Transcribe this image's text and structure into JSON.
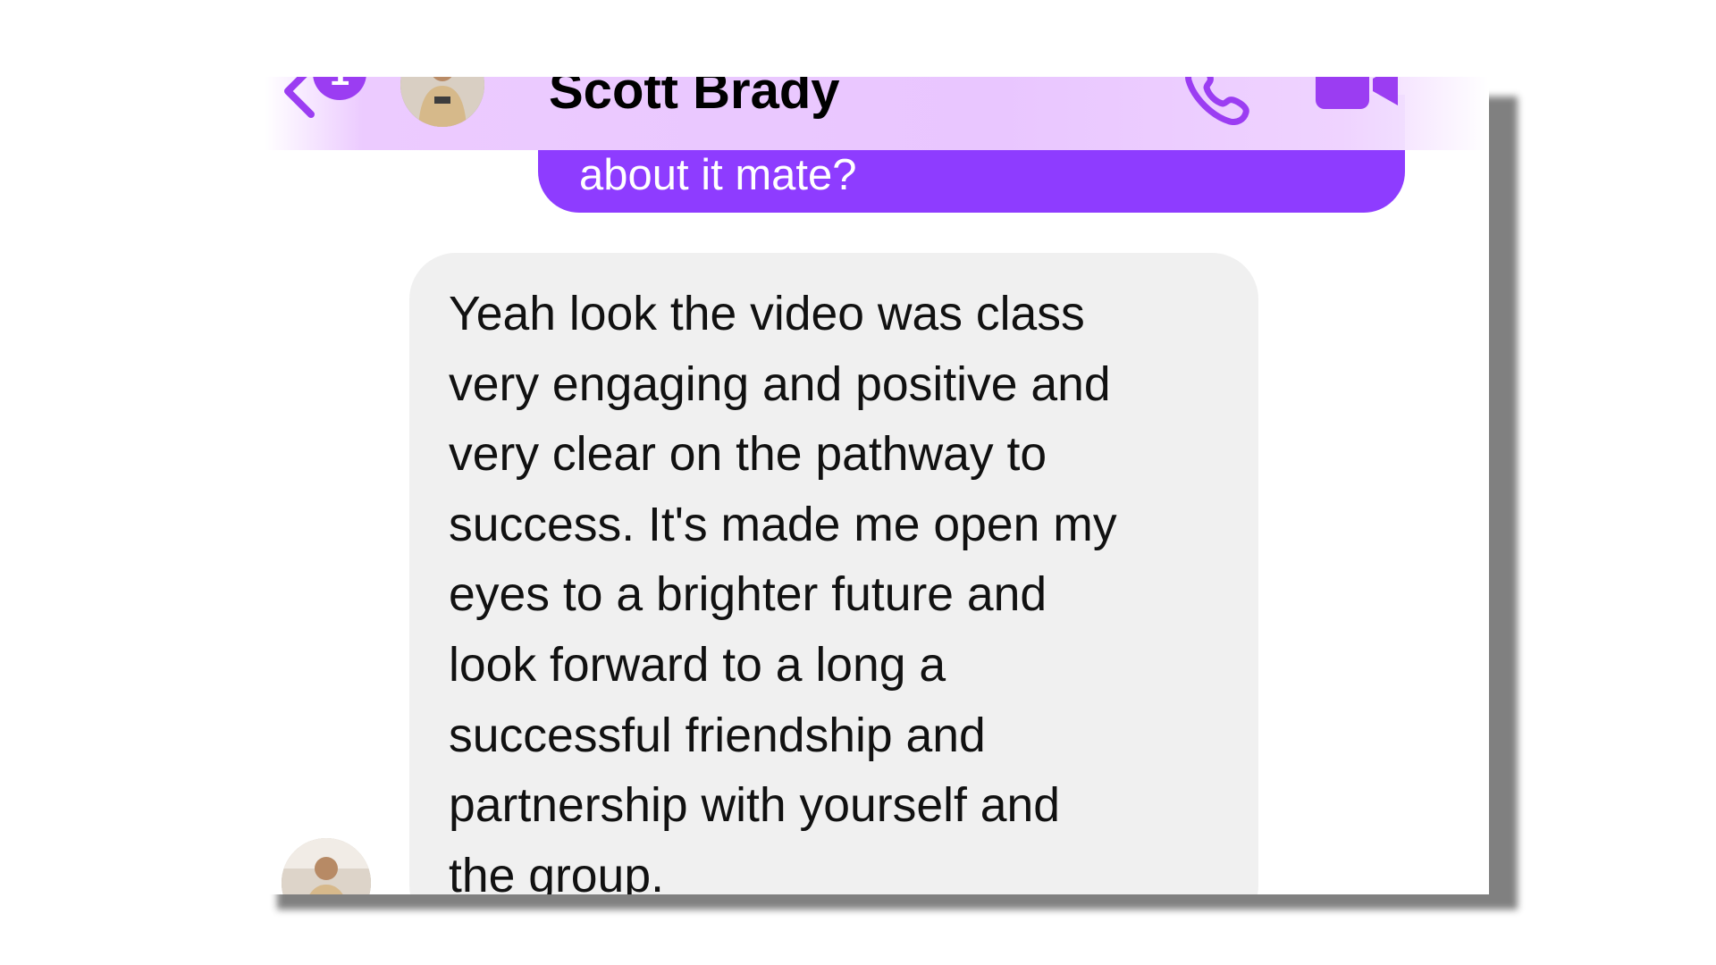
{
  "header": {
    "contact_name": "Scott Brady",
    "badge_text": "1",
    "accent_color": "#9b3df2",
    "header_tint": "#e9c6ff"
  },
  "icons": {
    "back": "chevron-left-icon",
    "call": "phone-icon",
    "video": "video-camera-icon"
  },
  "messages": {
    "outgoing_fragment": "about it mate?",
    "incoming_text": "Yeah look the video was class\nvery engaging and positive and\nvery clear on the pathway to\nsuccess. It's made me open my\neyes to a brighter future and\nlook forward to a long a\nsuccessful friendship and\npartnership with yourself and\nthe group.",
    "outgoing_bubble_color": "#8e3cff",
    "incoming_bubble_color": "#f0f0f0"
  }
}
